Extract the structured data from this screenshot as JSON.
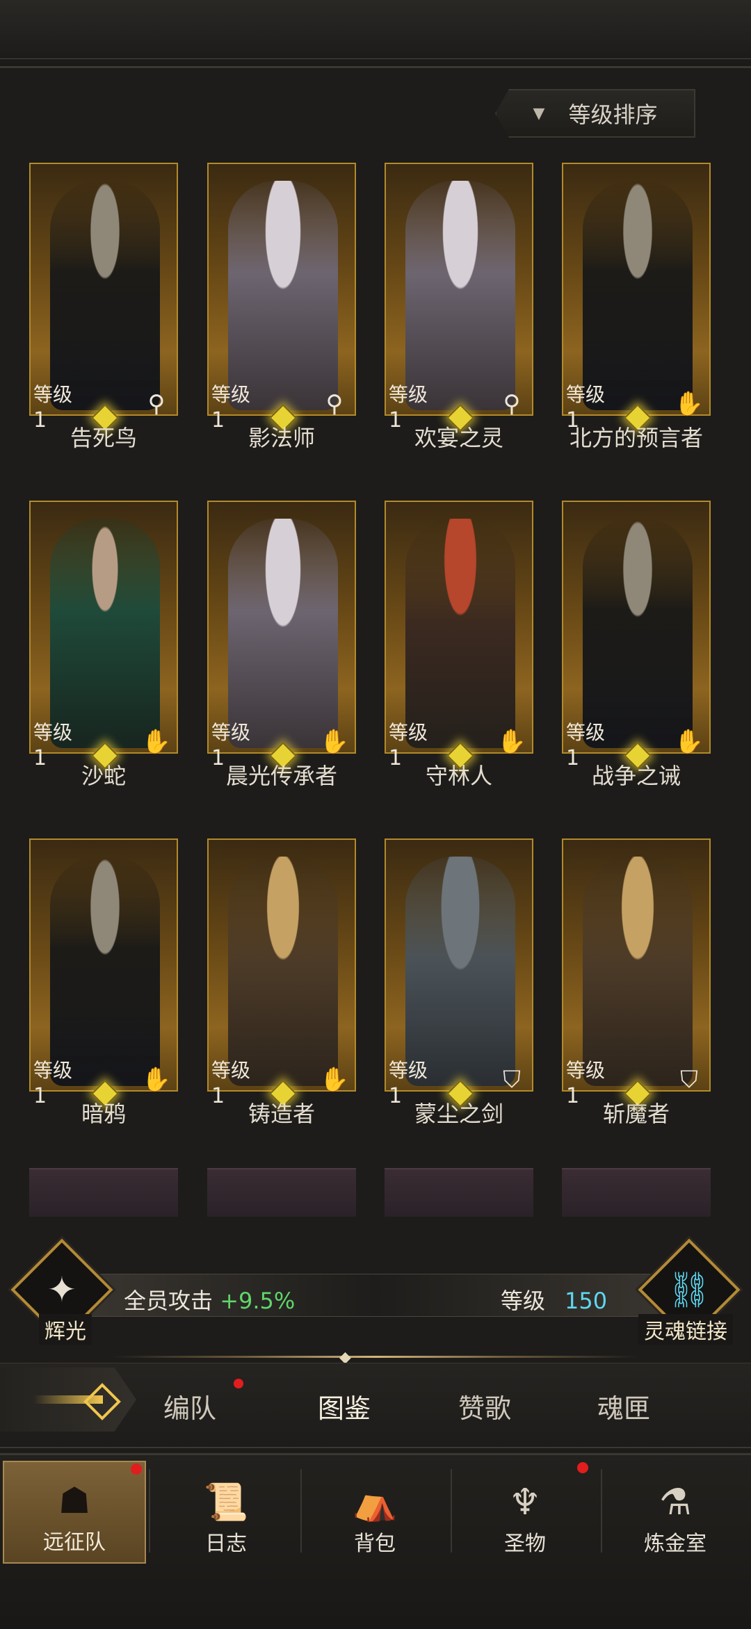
{
  "sort": {
    "label": "等级排序",
    "arrow": "▼"
  },
  "level_label": "等级",
  "heroes": [
    {
      "name": "告死鸟",
      "level": "1",
      "class_icon": "staff-icon"
    },
    {
      "name": "影法师",
      "level": "1",
      "class_icon": "staff-icon"
    },
    {
      "name": "欢宴之灵",
      "level": "1",
      "class_icon": "staff-icon"
    },
    {
      "name": "北方的预言者",
      "level": "1",
      "class_icon": "palm-icon"
    },
    {
      "name": "沙蛇",
      "level": "1",
      "class_icon": "palm-icon"
    },
    {
      "name": "晨光传承者",
      "level": "1",
      "class_icon": "palm-icon"
    },
    {
      "name": "守林人",
      "level": "1",
      "class_icon": "palm-icon"
    },
    {
      "name": "战争之诫",
      "level": "1",
      "class_icon": "palm-icon"
    },
    {
      "name": "暗鸦",
      "level": "1",
      "class_icon": "palm-icon"
    },
    {
      "name": "铸造者",
      "level": "1",
      "class_icon": "palm-icon"
    },
    {
      "name": "蒙尘之剑",
      "level": "1",
      "class_icon": "shield-icon"
    },
    {
      "name": "斩魔者",
      "level": "1",
      "class_icon": "shield-icon"
    }
  ],
  "bonus": {
    "left_emblem_label": "辉光",
    "attack_label": "全员攻击",
    "attack_value": "+9.5%",
    "level_label": "等级",
    "level_value": "150",
    "right_emblem_label": "灵魂链接"
  },
  "tabs": [
    "编队",
    "图鉴",
    "赞歌",
    "魂匣"
  ],
  "nav": [
    "远征队",
    "日志",
    "背包",
    "圣物",
    "炼金室"
  ],
  "colors": {
    "accent_gold": "#b38a2b",
    "bonus_green": "#5fd66a",
    "level_cyan": "#5fd7f0",
    "badge_red": "#e21d1d"
  }
}
